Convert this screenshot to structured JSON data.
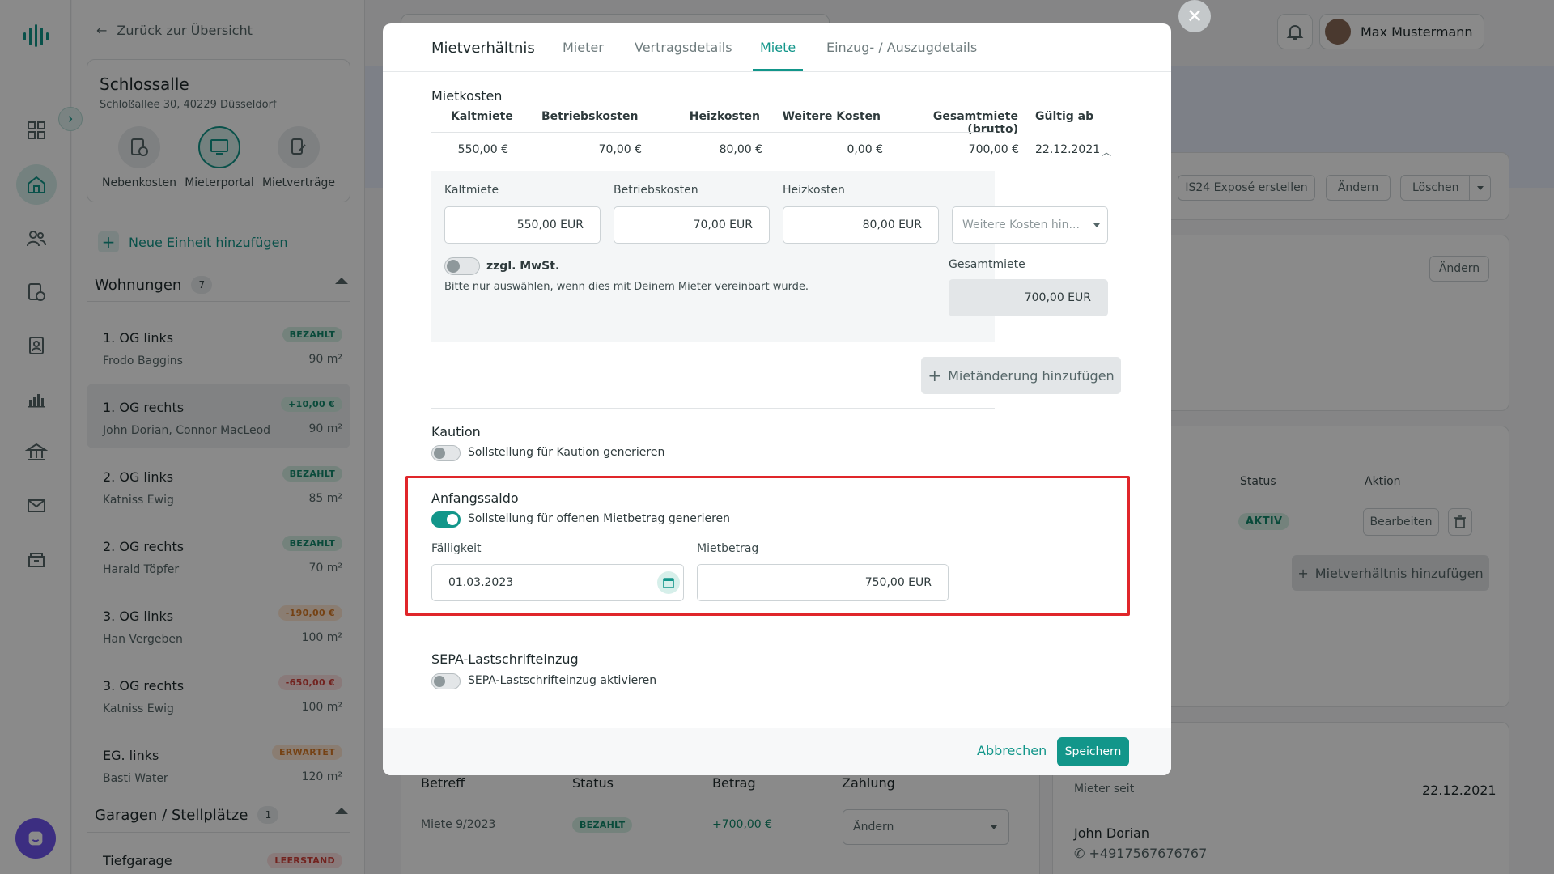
{
  "sidebar_panel": {
    "back_label": "Zurück zur Übersicht",
    "property": {
      "name": "Schlossalle",
      "address": "Schloßallee 30, 40229 Düsseldorf"
    },
    "property_actions": [
      {
        "label": "Nebenkosten",
        "icon": "receipt-icon"
      },
      {
        "label": "Mieterportal",
        "icon": "monitor-icon"
      },
      {
        "label": "Mietverträge",
        "icon": "contract-icon"
      }
    ],
    "new_unit_label": "Neue Einheit hinzufügen",
    "apartments_heading": "Wohnungen",
    "apartments_count": "7",
    "units": [
      {
        "name": "1. OG links",
        "tenant": "Frodo Baggins",
        "area": "90 m²",
        "badge": "BEZAHLT",
        "badge_type": "green"
      },
      {
        "name": "1. OG rechts",
        "tenant": "John Dorian, Connor MacLeod",
        "area": "90 m²",
        "badge": "+10,00 €",
        "badge_type": "green"
      },
      {
        "name": "2. OG links",
        "tenant": "Katniss Ewig",
        "area": "85 m²",
        "badge": "BEZAHLT",
        "badge_type": "green"
      },
      {
        "name": "2. OG rechts",
        "tenant": "Harald Töpfer",
        "area": "70 m²",
        "badge": "BEZAHLT",
        "badge_type": "green"
      },
      {
        "name": "3. OG links",
        "tenant": "Han Vergeben",
        "area": "100 m²",
        "badge": "-190,00 €",
        "badge_type": "orange"
      },
      {
        "name": "3. OG rechts",
        "tenant": "Katniss Ewig",
        "area": "100 m²",
        "badge": "-650,00 €",
        "badge_type": "red"
      },
      {
        "name": "EG. links",
        "tenant": "Basti Water",
        "area": "120 m²",
        "badge": "ERWARTET",
        "badge_type": "orange"
      }
    ],
    "garages_heading": "Garagen / Stellplätze",
    "garages_count": "1",
    "garage_unit": {
      "name": "Tiefgarage",
      "badge": "LEERSTAND"
    }
  },
  "topbar": {
    "user_name": "Max Mustermann"
  },
  "background": {
    "btn_expose": "IS24 Exposé erstellen",
    "btn_edit": "Ändern",
    "btn_delete": "Löschen",
    "btn_edit2": "Ändern",
    "status_col": "Status",
    "action_col": "Aktion",
    "status_value": "AKTIV",
    "btn_bearbeiten": "Bearbeiten",
    "btn_add_tenancy": "Mietverhältnis hinzufügen",
    "payments_headers": [
      "Betreff",
      "Status",
      "Betrag",
      "Zahlung"
    ],
    "payment_row": {
      "subject": "Miete 9/2023",
      "status": "BEZAHLT",
      "amount": "+700,00 €",
      "action": "Ändern"
    },
    "tenant_since_label": "Mieter seit",
    "tenant_since_value": "22.12.2021",
    "tenant_name": "John Dorian",
    "tenant_phone": "+4917567676767"
  },
  "modal": {
    "title": "Mietverhältnis",
    "tabs": [
      "Mieter",
      "Vertragsdetails",
      "Miete",
      "Einzug- / Auszugdetails"
    ],
    "active_tab": "Miete",
    "rent_costs_heading": "Mietkosten",
    "table_headers": [
      "Kaltmiete",
      "Betriebskosten",
      "Heizkosten",
      "Weitere Kosten",
      "Gesamtmiete (brutto)",
      "Gültig ab"
    ],
    "table_row": [
      "550,00 €",
      "70,00 €",
      "80,00 €",
      "0,00 €",
      "700,00 €",
      "22.12.2021"
    ],
    "edit": {
      "cold_rent_label": "Kaltmiete",
      "cold_rent_value": "550,00  EUR",
      "operating_label": "Betriebskosten",
      "operating_value": "70,00  EUR",
      "heating_label": "Heizkosten",
      "heating_value": "80,00  EUR",
      "more_costs_placeholder": "Weitere Kosten hin...",
      "vat_label": "zzgl. MwSt.",
      "vat_hint": "Bitte nur auswählen, wenn dies mit Deinem Mieter vereinbart wurde.",
      "total_label": "Gesamtmiete",
      "total_value": "700,00  EUR"
    },
    "add_rent_change_label": "Mietänderung hinzufügen",
    "deposit_heading": "Kaution",
    "deposit_toggle_label": "Sollstellung für Kaution generieren",
    "opening_heading": "Anfangssaldo",
    "opening_toggle_label": "Sollstellung für offenen Mietbetrag generieren",
    "due_label": "Fälligkeit",
    "due_value": "01.03.2023",
    "amount_label": "Mietbetrag",
    "amount_value": "750,00  EUR",
    "sepa_heading": "SEPA-Lastschrifteinzug",
    "sepa_toggle_label": "SEPA-Lastschrifteinzug aktivieren",
    "cancel_label": "Abbrechen",
    "save_label": "Speichern"
  },
  "colors": {
    "accent": "#12968a",
    "highlight_border": "#e0262a"
  }
}
